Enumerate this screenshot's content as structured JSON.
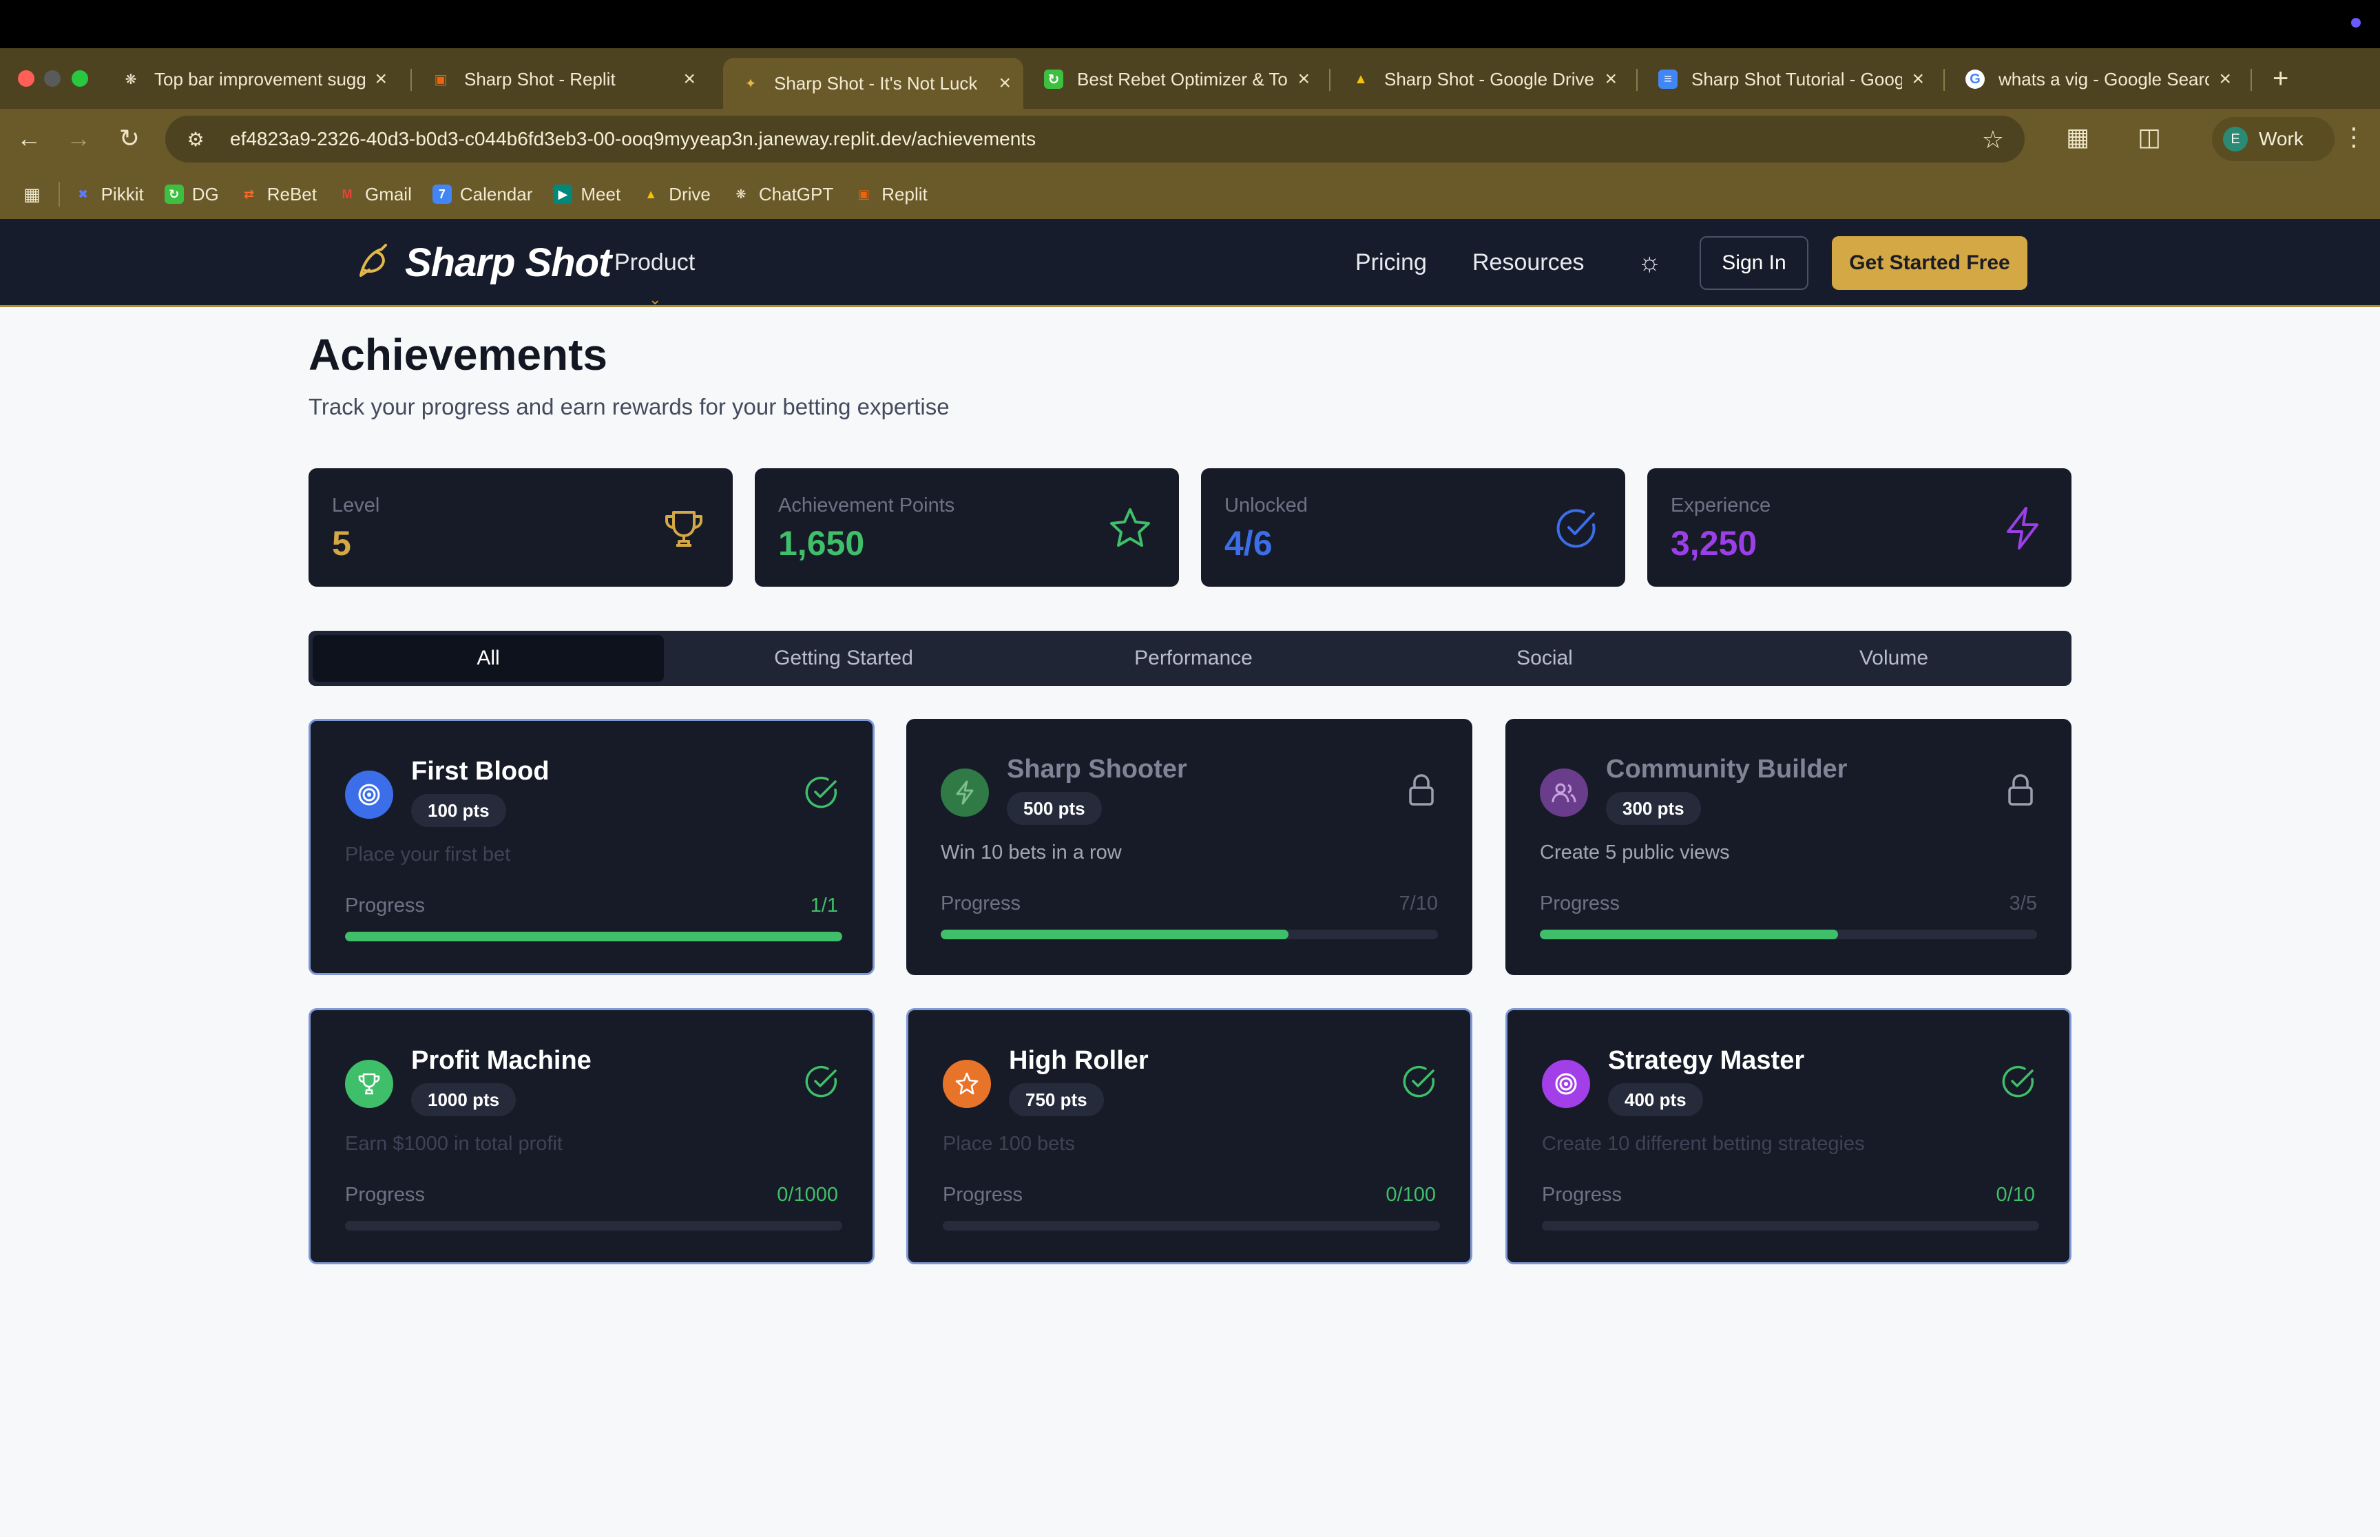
{
  "browser": {
    "tabs": [
      {
        "title": "Top bar improvement sugg",
        "icon": "chatgpt-icon"
      },
      {
        "title": "Sharp Shot - Replit",
        "icon": "replit-icon"
      },
      {
        "title": "Sharp Shot - It's Not Luck",
        "icon": "sharpshot-icon",
        "active": true
      },
      {
        "title": "Best Rebet Optimizer & To",
        "icon": "rebet-icon"
      },
      {
        "title": "Sharp Shot - Google Drive",
        "icon": "drive-icon"
      },
      {
        "title": "Sharp Shot Tutorial - Goog",
        "icon": "docs-icon"
      },
      {
        "title": "whats a vig - Google Searc",
        "icon": "google-icon"
      }
    ],
    "url": "ef4823a9-2326-40d3-b0d3-c044b6fd3eb3-00-ooq9myyeap3n.janeway.replit.dev/achievements",
    "profile": {
      "initial": "E",
      "label": "Work"
    },
    "bookmarks": [
      "Pikkit",
      "DG",
      "ReBet",
      "Gmail",
      "Calendar",
      "Meet",
      "Drive",
      "ChatGPT",
      "Replit"
    ]
  },
  "nav": {
    "brand": "Sharp Shot",
    "product": "Product",
    "pricing": "Pricing",
    "resources": "Resources",
    "sign_in": "Sign In",
    "cta": "Get Started Free"
  },
  "page": {
    "title": "Achievements",
    "subtitle": "Track your progress and earn rewards for your betting expertise"
  },
  "stats": [
    {
      "label": "Level",
      "value": "5",
      "color": "#d4a844",
      "icon": "trophy-icon"
    },
    {
      "label": "Achievement Points",
      "value": "1,650",
      "color": "#3fbf6a",
      "icon": "star-icon"
    },
    {
      "label": "Unlocked",
      "value": "4/6",
      "color": "#3b6ee8",
      "icon": "check-circle-icon"
    },
    {
      "label": "Experience",
      "value": "3,250",
      "color": "#9b3fe8",
      "icon": "lightning-icon"
    }
  ],
  "filters": [
    "All",
    "Getting Started",
    "Performance",
    "Social",
    "Volume"
  ],
  "achievements": [
    {
      "title": "First Blood",
      "points": "100 pts",
      "description": "Place your first bet",
      "progress_label": "Progress",
      "progress": "1/1",
      "fraction": 1.0,
      "unlocked": true,
      "icon": "target-icon",
      "color": "#3b6ee8"
    },
    {
      "title": "Sharp Shooter",
      "points": "500 pts",
      "description": "Win 10 bets in a row",
      "progress_label": "Progress",
      "progress": "7/10",
      "fraction": 0.7,
      "unlocked": false,
      "icon": "lightning-icon",
      "color": "#2f7a45"
    },
    {
      "title": "Community Builder",
      "points": "300 pts",
      "description": "Create 5 public views",
      "progress_label": "Progress",
      "progress": "3/5",
      "fraction": 0.6,
      "unlocked": false,
      "icon": "users-icon",
      "color": "#6a3d8c"
    },
    {
      "title": "Profit Machine",
      "points": "1000 pts",
      "description": "Earn $1000 in total profit",
      "progress_label": "Progress",
      "progress": "0/1000",
      "fraction": 0.0,
      "unlocked": true,
      "icon": "trophy-icon",
      "color": "#3fbf6a"
    },
    {
      "title": "High Roller",
      "points": "750 pts",
      "description": "Place 100 bets",
      "progress_label": "Progress",
      "progress": "0/100",
      "fraction": 0.0,
      "unlocked": true,
      "icon": "star-icon",
      "color": "#e8742a"
    },
    {
      "title": "Strategy Master",
      "points": "400 pts",
      "description": "Create 10 different betting strategies",
      "progress_label": "Progress",
      "progress": "0/10",
      "fraction": 0.0,
      "unlocked": true,
      "icon": "target-icon",
      "color": "#a23fe8"
    }
  ]
}
